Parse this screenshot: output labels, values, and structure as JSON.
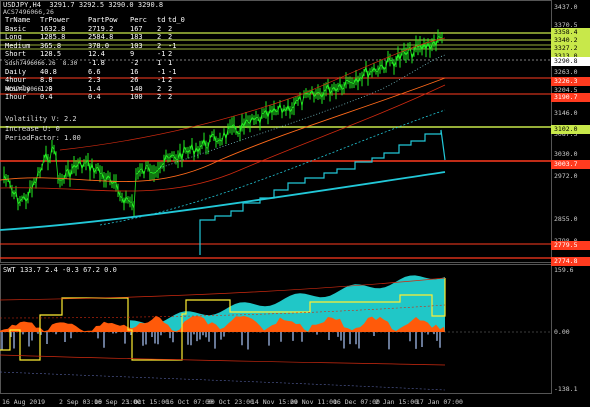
{
  "window": {
    "title": "USDJPY,H4  3291.7 3292.5 3290.0 3290.8",
    "subtitle": "ACS7496066,26",
    "indicator_title": "SWT 133.7 2.4 -0.3 67.2 0.0"
  },
  "table": {
    "headers": [
      "TrName",
      "TrPower",
      "PartPow",
      "Perc",
      "td",
      "td_0"
    ],
    "rows": [
      [
        "Basic",
        "1632.8",
        "2719.2",
        "167",
        "2",
        "2"
      ],
      [
        "Long",
        "1285.8",
        "2584.8",
        "183",
        "2",
        "2"
      ],
      [
        "Medium",
        "365.8",
        "378.0",
        "103",
        "2",
        "-1"
      ],
      [
        "Short",
        "128.5",
        "12.4",
        "9",
        "-1",
        "2"
      ],
      [
        "Weekly",
        "79.8",
        "-1.8",
        "-2",
        "1",
        "1"
      ],
      [
        "Daily",
        "40.8",
        "6.6",
        "16",
        "-1",
        "-1"
      ],
      [
        "4hour",
        "8.8",
        "2.3",
        "26",
        "-1",
        "2"
      ],
      [
        "Hourly",
        "1.0",
        "1.4",
        "140",
        "2",
        "2"
      ],
      [
        "Ihour",
        "0.4",
        "0.4",
        "100",
        "2",
        "2"
      ]
    ],
    "overlay_label_1": "Sdsh7496066.26  8.30",
    "overlay_label_2": "ACS7496066.25",
    "volatility": "Volatility V: 2.2",
    "increase": "Increase U: 0",
    "period_factor": "PeriodFactor: 1.00"
  },
  "price_axis": {
    "plain": [
      "3437.0",
      "3370.5",
      "3263.0",
      "3204.5",
      "3146.0",
      "3087.5",
      "3030.0",
      "2972.0",
      "2855.0",
      "2798.0"
    ],
    "tagged": [
      {
        "text": "3358.4",
        "color": "#c8e84a",
        "fg": "#000"
      },
      {
        "text": "3340.2",
        "color": "#c8e84a",
        "fg": "#000"
      },
      {
        "text": "3327.2",
        "color": "#c8e84a",
        "fg": "#000"
      },
      {
        "text": "3313.0",
        "color": "#c8e84a",
        "fg": "#000"
      },
      {
        "text": "3290.8",
        "color": "#ffffff",
        "fg": "#000"
      },
      {
        "text": "3226.3",
        "color": "#ff3b1f",
        "fg": "#fff"
      },
      {
        "text": "3190.7",
        "color": "#ff3b1f",
        "fg": "#fff"
      },
      {
        "text": "3102.0",
        "color": "#c8e84a",
        "fg": "#000"
      },
      {
        "text": "3003.7",
        "color": "#ff3b1f",
        "fg": "#fff"
      },
      {
        "text": "2779.5",
        "color": "#ff3b1f",
        "fg": "#fff"
      },
      {
        "text": "2774.8",
        "color": "#ff3b1f",
        "fg": "#fff"
      }
    ]
  },
  "indicator_axis": {
    "labels": [
      "159.6",
      "0.00",
      "-138.1"
    ]
  },
  "time_axis": {
    "labels": [
      "16 Aug 2019",
      "2 Sep 03:00",
      "16 Sep 23:00",
      "1 Oct 15:00",
      "16 Oct 07:00",
      "30 Oct 23:00",
      "14 Nov 15:00",
      "29 Nov 11:00",
      "16 Dec 07:00",
      "2 Jan 15:00",
      "17 Jan 07:00"
    ]
  },
  "colors": {
    "price": "#22ee22",
    "cyan_line": "#22c8d8",
    "orange_line": "#ff6a1a",
    "red_line": "#d02a10",
    "lime_level": "#c8e84a",
    "red_level": "#ff3b1f",
    "yellow_wave": "#ffee33",
    "fill_cyan": "#22d2d2",
    "fill_orange": "#ff5a0a"
  }
}
